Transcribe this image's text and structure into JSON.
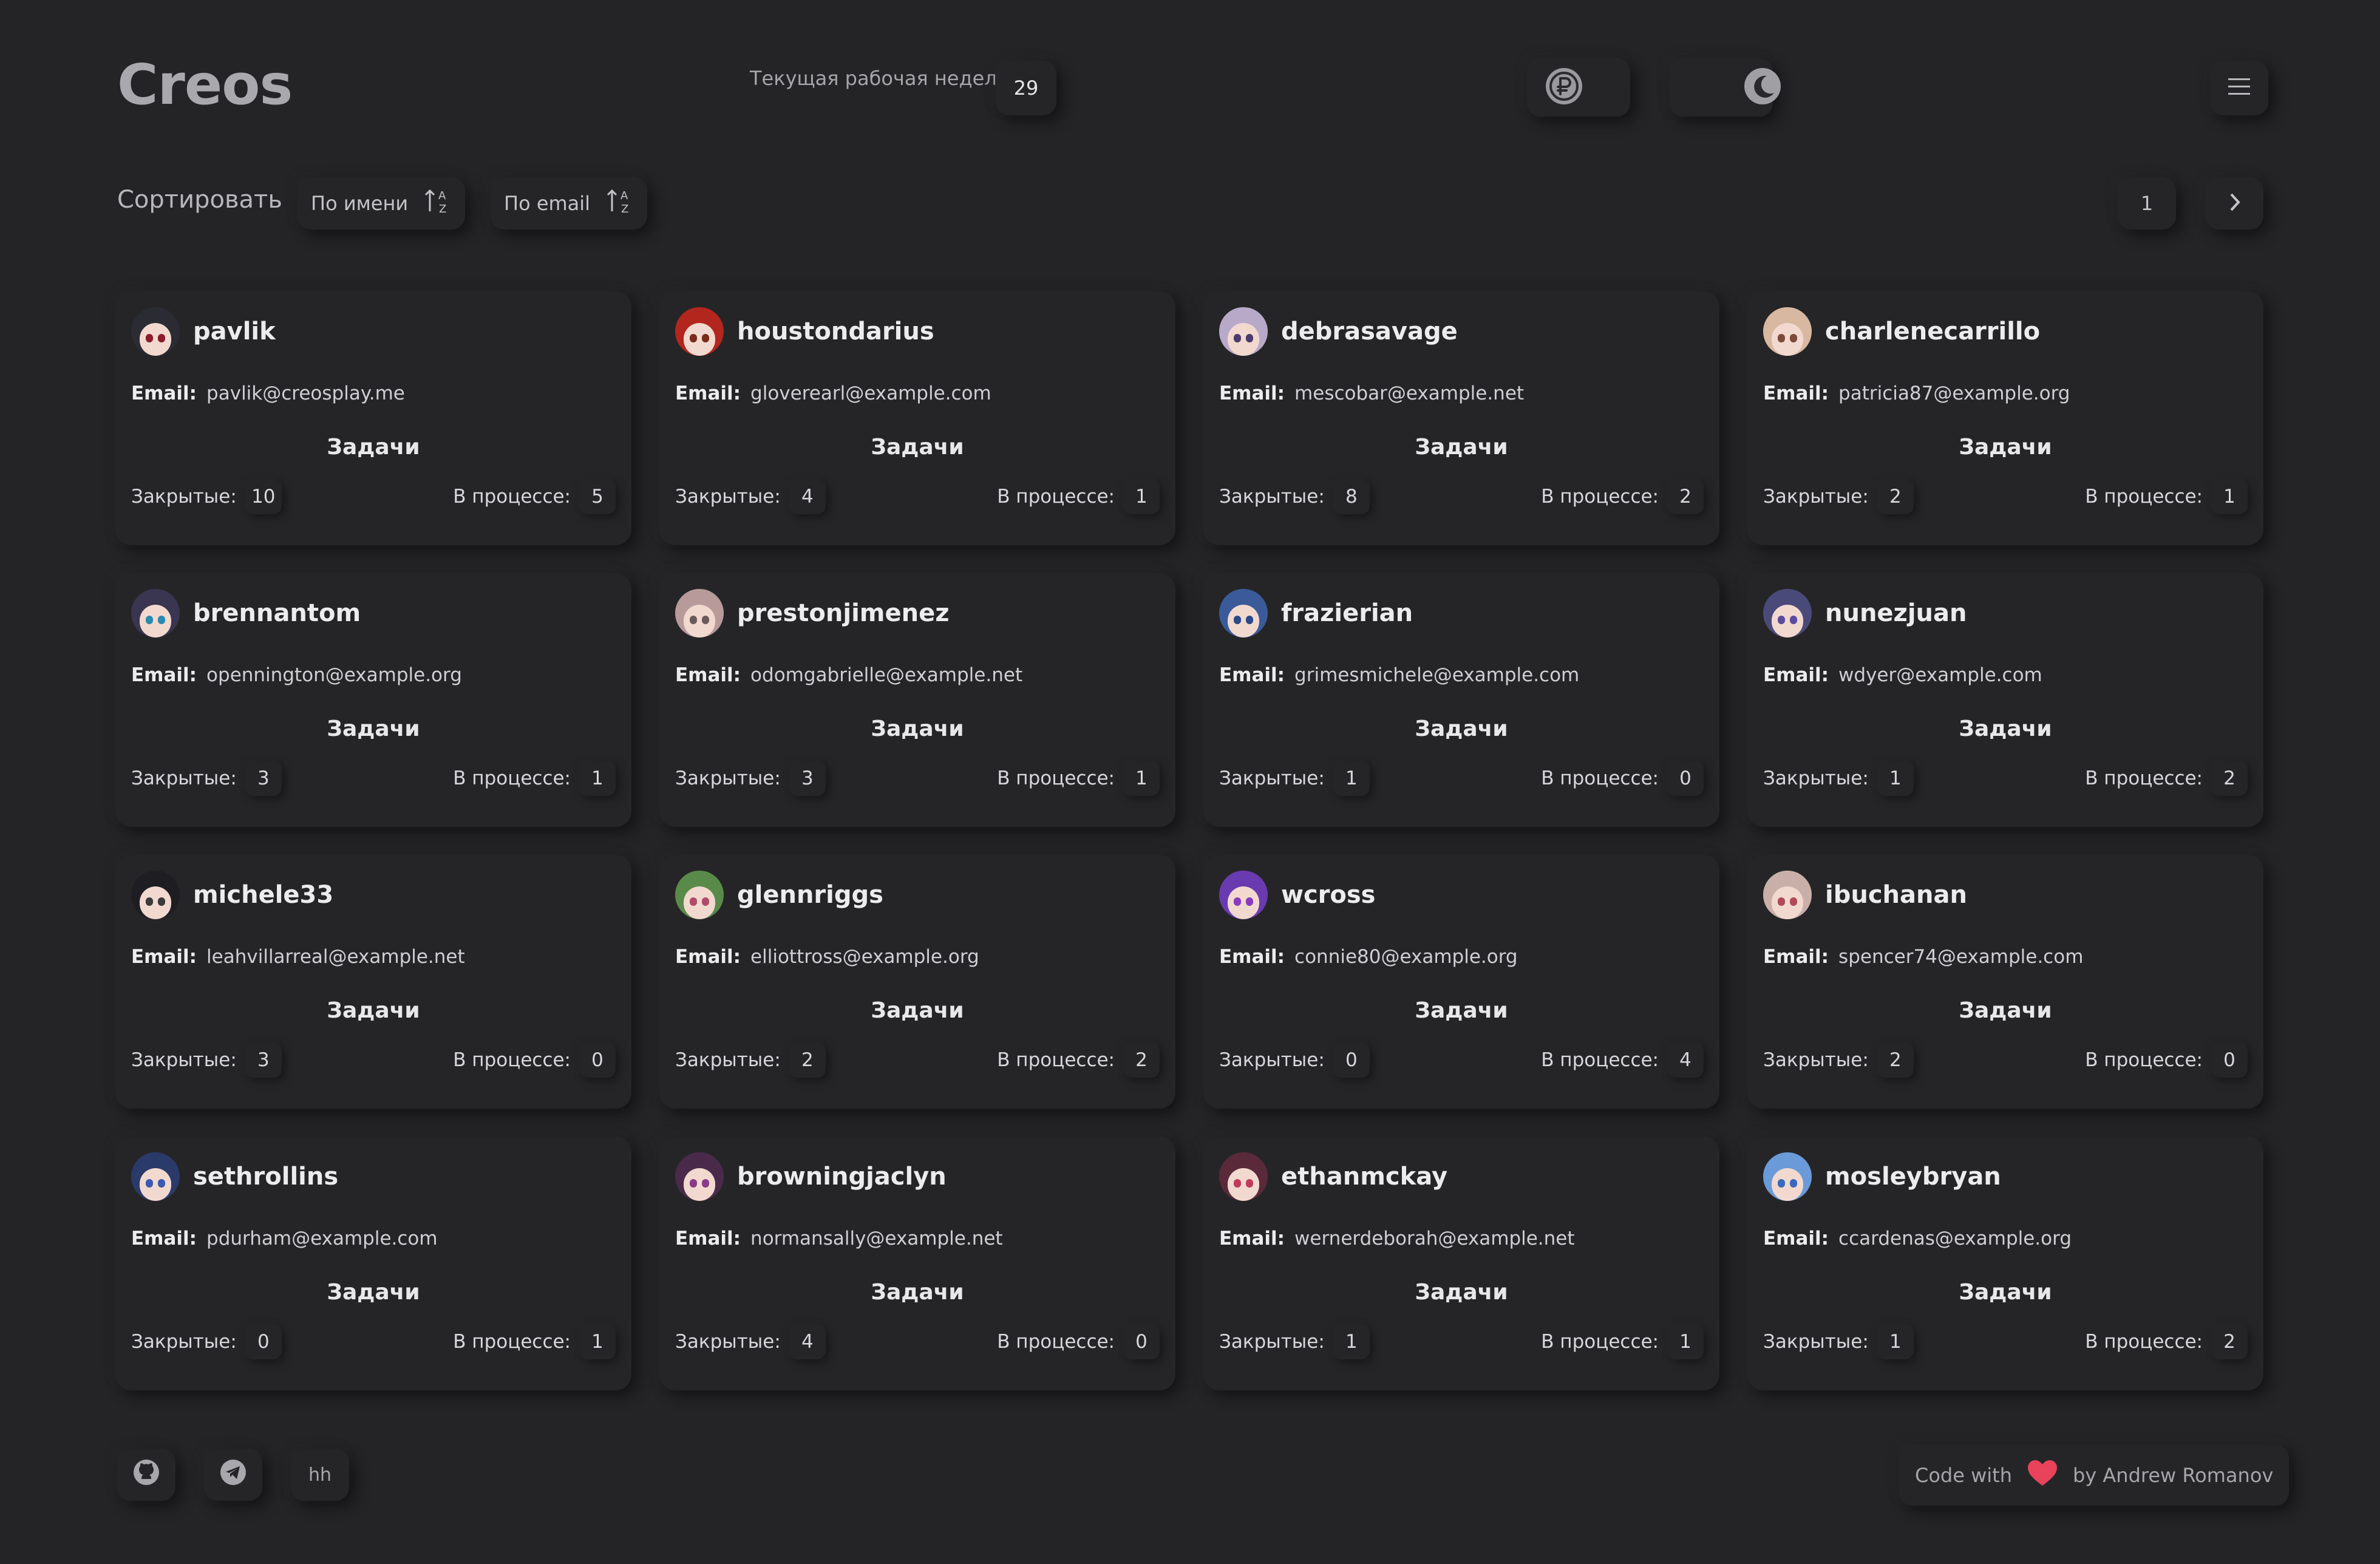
{
  "header": {
    "logo": "Creos",
    "week_label": "Текущая рабочая неделя",
    "week_number": "29",
    "currency_icon": "ruble-icon",
    "theme_icon": "moon-icon",
    "menu_icon": "hamburger-icon"
  },
  "sort": {
    "label": "Сортировать",
    "by_name": "По имени",
    "by_email": "По email"
  },
  "pagination": {
    "current": "1"
  },
  "labels": {
    "email": "Email:",
    "tasks": "Задачи",
    "closed": "Закрытые:",
    "in_progress": "В процессе:"
  },
  "users": [
    {
      "name": "pavlik",
      "email": "pavlik@creosplay.me",
      "closed": "10",
      "progress": "5",
      "hair": "#2b2b33",
      "eye": "#8a1c2c"
    },
    {
      "name": "houstondarius",
      "email": "gloverearl@example.com",
      "closed": "4",
      "progress": "1",
      "hair": "#b3261e",
      "eye": "#7a2a1a"
    },
    {
      "name": "debrasavage",
      "email": "mescobar@example.net",
      "closed": "8",
      "progress": "2",
      "hair": "#b8a9c9",
      "eye": "#4c3a6e"
    },
    {
      "name": "charlenecarrillo",
      "email": "patricia87@example.org",
      "closed": "2",
      "progress": "1",
      "hair": "#d8b8a0",
      "eye": "#7c4a3a"
    },
    {
      "name": "brennantom",
      "email": "opennington@example.org",
      "closed": "3",
      "progress": "1",
      "hair": "#3a3550",
      "eye": "#2a8ab0"
    },
    {
      "name": "prestonjimenez",
      "email": "odomgabrielle@example.net",
      "closed": "3",
      "progress": "1",
      "hair": "#b89a9a",
      "eye": "#6a5a5a"
    },
    {
      "name": "frazierian",
      "email": "grimesmichele@example.com",
      "closed": "1",
      "progress": "0",
      "hair": "#3a5a9a",
      "eye": "#2a4a8a"
    },
    {
      "name": "nunezjuan",
      "email": "wdyer@example.com",
      "closed": "1",
      "progress": "2",
      "hair": "#4a4a7a",
      "eye": "#5a4aa0"
    },
    {
      "name": "michele33",
      "email": "leahvillarreal@example.net",
      "closed": "3",
      "progress": "0",
      "hair": "#1e1e22",
      "eye": "#3a3a3a"
    },
    {
      "name": "glennriggs",
      "email": "elliottross@example.org",
      "closed": "2",
      "progress": "2",
      "hair": "#5a8a4a",
      "eye": "#b04a6a"
    },
    {
      "name": "wcross",
      "email": "connie80@example.org",
      "closed": "0",
      "progress": "4",
      "hair": "#6a3ab0",
      "eye": "#8a3ac0"
    },
    {
      "name": "ibuchanan",
      "email": "spencer74@example.com",
      "closed": "2",
      "progress": "0",
      "hair": "#c8b0a8",
      "eye": "#b04a5a"
    },
    {
      "name": "sethrollins",
      "email": "pdurham@example.com",
      "closed": "0",
      "progress": "1",
      "hair": "#2a3a6a",
      "eye": "#3a5ab0"
    },
    {
      "name": "browningjaclyn",
      "email": "normansally@example.net",
      "closed": "4",
      "progress": "0",
      "hair": "#4a2a4a",
      "eye": "#8a3a8a"
    },
    {
      "name": "ethanmckay",
      "email": "wernerdeborah@example.net",
      "closed": "1",
      "progress": "1",
      "hair": "#5a2a3a",
      "eye": "#c03a5a"
    },
    {
      "name": "mosleybryan",
      "email": "ccardenas@example.org",
      "closed": "1",
      "progress": "2",
      "hair": "#6a9ad8",
      "eye": "#3a6ac0"
    }
  ],
  "footer": {
    "github_icon": "github-icon",
    "telegram_icon": "telegram-icon",
    "hh": "hh",
    "code_with": "Code with",
    "heart_icon": "heart-icon",
    "by": "by Andrew Romanov",
    "heart_color": "#e8435a"
  }
}
